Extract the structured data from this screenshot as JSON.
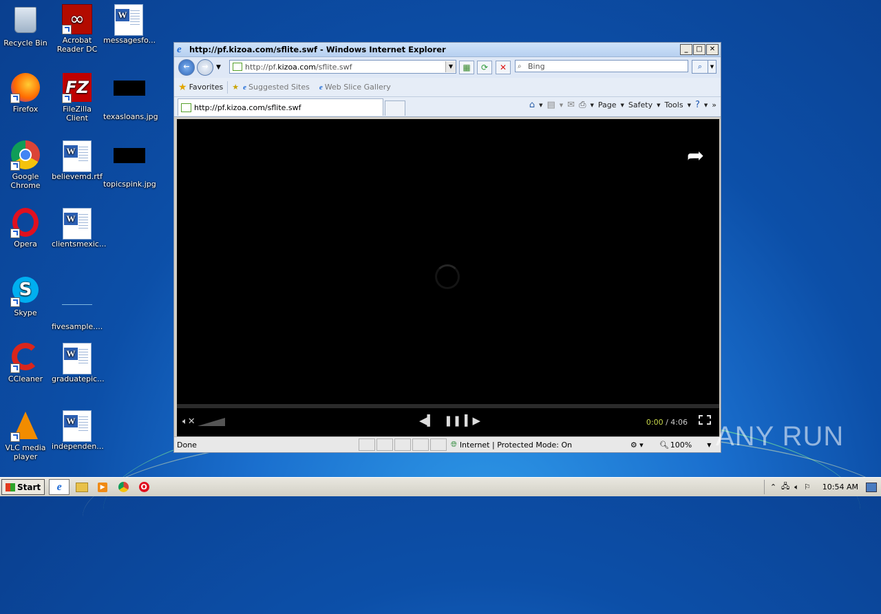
{
  "desktop": {
    "icons": [
      {
        "label": "Recycle Bin",
        "icon": "recycle-bin-icon"
      },
      {
        "label": "Acrobat Reader DC",
        "icon": "acrobat-icon"
      },
      {
        "label": "messagesfo...",
        "icon": "word-doc-icon"
      },
      {
        "label": "Firefox",
        "icon": "firefox-icon"
      },
      {
        "label": "FileZilla Client",
        "icon": "filezilla-icon"
      },
      {
        "label": "texasloans.jpg",
        "icon": "image-file-icon"
      },
      {
        "label": "Google Chrome",
        "icon": "chrome-icon"
      },
      {
        "label": "believemd.rtf",
        "icon": "word-doc-icon"
      },
      {
        "label": "topicspink.jpg",
        "icon": "image-file-icon"
      },
      {
        "label": "Opera",
        "icon": "opera-icon"
      },
      {
        "label": "clientsmexic...",
        "icon": "word-doc-icon"
      },
      {
        "label": "Skype",
        "icon": "skype-icon"
      },
      {
        "label": "fivesample....",
        "icon": "file-icon"
      },
      {
        "label": "CCleaner",
        "icon": "ccleaner-icon"
      },
      {
        "label": "graduatepic...",
        "icon": "word-doc-icon"
      },
      {
        "label": "VLC media player",
        "icon": "vlc-icon"
      },
      {
        "label": "independen...",
        "icon": "word-doc-icon"
      }
    ],
    "watermark": "ANY RUN"
  },
  "ie": {
    "title": "http://pf.kizoa.com/sflite.swf - Windows Internet Explorer",
    "address_prefix": "http://pf.",
    "address_domain": "kizoa.com",
    "address_path": "/sflite.swf",
    "search_placeholder": "Bing",
    "favorites_label": "Favorites",
    "suggested_sites": "Suggested Sites",
    "web_slice_gallery": "Web Slice Gallery",
    "tab_title": "http://pf.kizoa.com/sflite.swf",
    "cmd_page": "Page",
    "cmd_safety": "Safety",
    "cmd_tools": "Tools",
    "status_text": "Done",
    "zone_text": "Internet | Protected Mode: On",
    "zoom": "100%"
  },
  "player": {
    "time_current": "0:00",
    "time_total": "4:06",
    "time_sep": " / "
  },
  "taskbar": {
    "start_label": "Start",
    "clock": "10:54 AM"
  }
}
